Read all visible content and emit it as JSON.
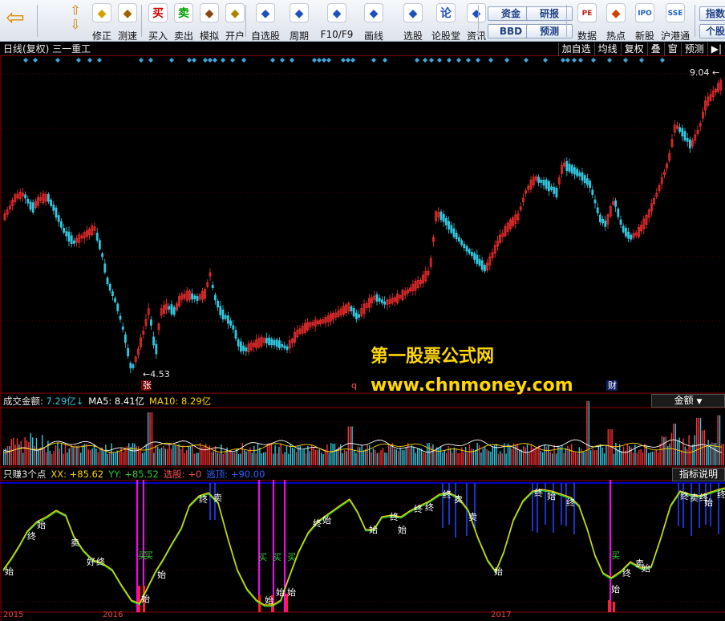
{
  "toolbar": {
    "buttons": [
      {
        "label": "修正",
        "icon": "smile-icon"
      },
      {
        "label": "测速",
        "icon": "clock-icon"
      },
      {
        "label": "买入",
        "icon": "buy-icon",
        "glyph": "买"
      },
      {
        "label": "卖出",
        "icon": "sell-icon",
        "glyph": "卖"
      },
      {
        "label": "模拟",
        "icon": "gavel-icon"
      },
      {
        "label": "开户",
        "icon": "lock-icon"
      },
      {
        "label": "自选股",
        "icon": "star-icon"
      },
      {
        "label": "周期",
        "icon": "period-icon"
      },
      {
        "label": "F10/F9",
        "icon": "f10-icon"
      },
      {
        "label": "画线",
        "icon": "pen-icon"
      },
      {
        "label": "选股",
        "icon": "screen-icon"
      },
      {
        "label": "论股堂",
        "icon": "forum-icon",
        "glyph": "论"
      },
      {
        "label": "资讯",
        "icon": "news-icon"
      },
      {
        "label": "数据",
        "icon": "pe-icon",
        "glyph": "PE"
      },
      {
        "label": "热点",
        "icon": "hot-icon"
      },
      {
        "label": "新股",
        "icon": "ipo-icon",
        "glyph": "IPO"
      },
      {
        "label": "沪港通",
        "icon": "hk-icon",
        "glyph": "SSE"
      }
    ],
    "small_buttons": [
      "资金",
      "BBD",
      "研报",
      "预测",
      "指数",
      "个股"
    ]
  },
  "kline": {
    "title": "日线(复权) 三一重工",
    "actions": [
      "加自选",
      "均线",
      "复权",
      "叠",
      "窗",
      "预测"
    ],
    "high_label": "9.04",
    "low_label": "4.53",
    "tags": {
      "zhang": "张",
      "q": "q",
      "cai": "财"
    }
  },
  "watermark": {
    "line1": "第一股票公式网",
    "line2": "www.chnmoney.com"
  },
  "volume": {
    "label": "成交金额: ",
    "value": "7.29亿",
    "ma5": "MA5: 8.41亿",
    "ma10": "MA10: 8.29亿",
    "button": "金额"
  },
  "indicator": {
    "name": "只赚3个点",
    "xx": "XX: +85.62",
    "yy": "YY: +85.52",
    "select": "选股: +0",
    "top": "逃顶: +90.00",
    "button": "指标说明",
    "marks": {
      "buy": "买",
      "start": "始",
      "end": "终",
      "sell": "卖",
      "good": "好"
    }
  },
  "dates": [
    "2015",
    "2016",
    "2017"
  ],
  "colors": {
    "up": "#ff3030",
    "down": "#30c8e0",
    "ma5": "#ffffff",
    "ma10": "#ffd700",
    "xx": "#ffd700",
    "yy": "#32cd32",
    "top_line": "#0000ff",
    "buy_bar": "#ff00ff",
    "sell_bar": "#2040ff"
  }
}
